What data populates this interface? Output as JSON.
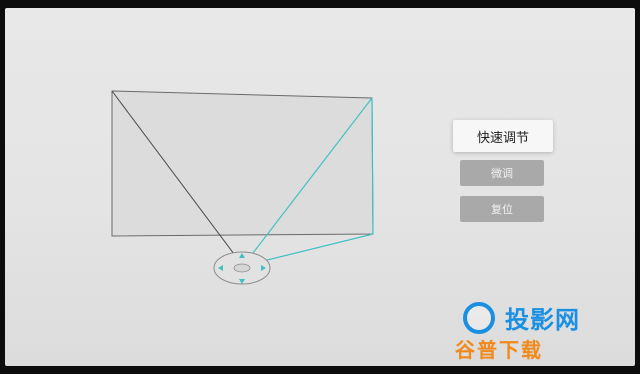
{
  "menu": {
    "quick_adjust": "快速调节",
    "fine_tune": "微调",
    "reset": "复位"
  },
  "watermark": {
    "title": "投影网",
    "subtitle": "谷普下载"
  },
  "colors": {
    "screen_bg": "#e6e6e6",
    "accent_cyan": "#3fc1c0",
    "keystone_outline": "#6a6a6a",
    "button_primary_bg": "#f7f7f7",
    "button_secondary_bg": "#a9a9a9",
    "watermark_blue": "#1a8fe3",
    "watermark_orange": "#f08a1c"
  },
  "icons": {
    "direction_pad": "direction-pad-icon",
    "arrow_up": "arrow-up-icon",
    "arrow_down": "arrow-down-icon",
    "arrow_left": "arrow-left-icon",
    "arrow_right": "arrow-right-icon",
    "watermark_logo": "watermark-logo-icon"
  }
}
